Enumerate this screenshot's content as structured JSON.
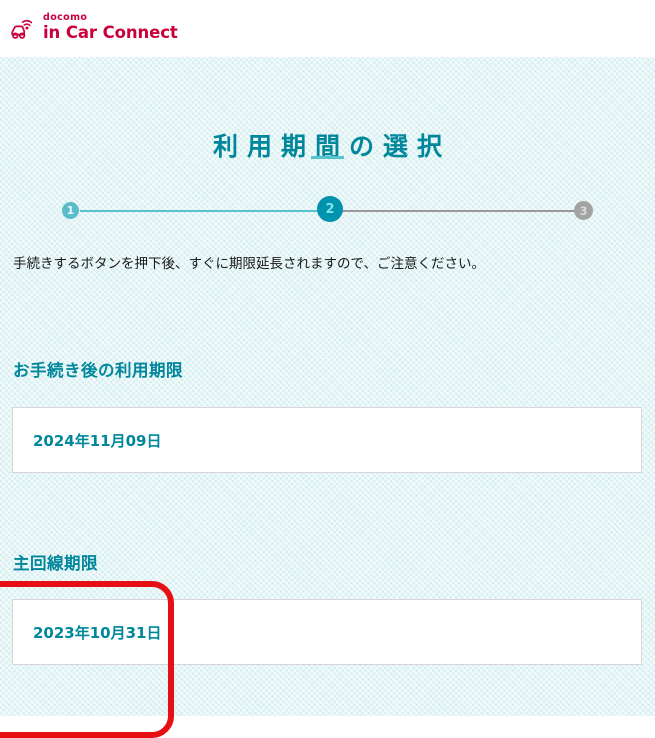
{
  "header": {
    "brand": {
      "icon": "car-wifi-icon",
      "line1": "docomo",
      "line2": "in Car Connect",
      "color": "#c9003c"
    }
  },
  "page": {
    "title": "利用期間の選択",
    "notice": "手続きするボタンを押下後、すぐに期限延長されますので、ご注意ください。",
    "background_color": "#e6f5f6",
    "accent_color": "#00879b"
  },
  "stepper": {
    "steps": [
      {
        "number": "1",
        "state": "completed",
        "color": "#5bbcca"
      },
      {
        "number": "2",
        "state": "current",
        "color": "#0093ad"
      },
      {
        "number": "3",
        "state": "pending",
        "color": "#a3a3a3"
      }
    ]
  },
  "sections": [
    {
      "heading": "お手続き後の利用期限",
      "date": "2024年11月09日"
    },
    {
      "heading": "主回線期限",
      "date": "2023年10月31日"
    }
  ],
  "annotation": {
    "shape": "rounded-rectangle",
    "color": "#e60f14"
  }
}
